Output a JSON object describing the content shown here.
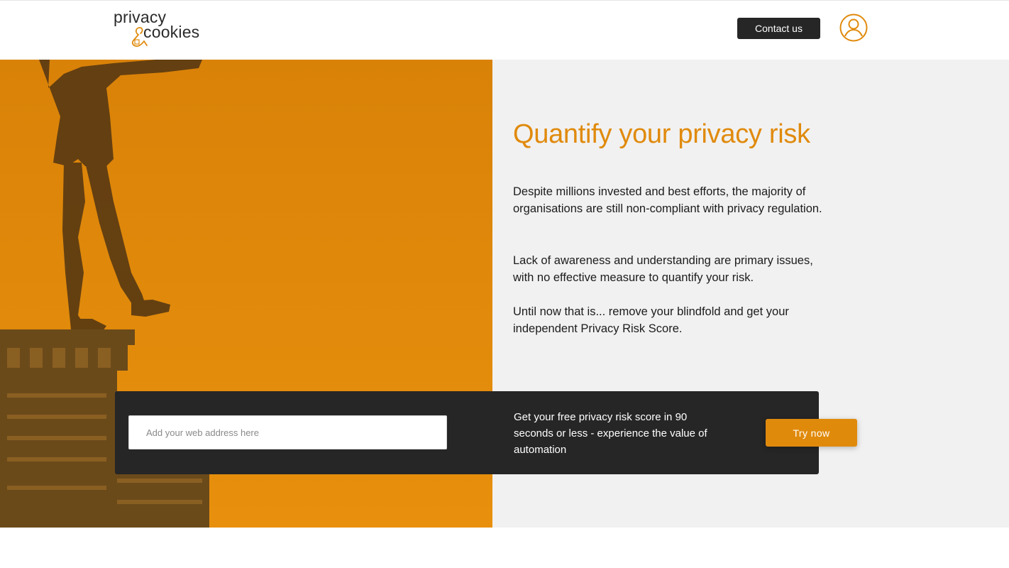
{
  "header": {
    "logo_line1": "privacy",
    "logo_line2": "cookies",
    "contact_label": "Contact us"
  },
  "hero": {
    "headline": "Quantify your privacy risk",
    "paragraphs": [
      "Despite millions invested and best efforts, the majority of organisations are still non-compliant with privacy regulation.",
      "Lack of awareness and understanding are primary issues, with no effective measure to quantify your risk.",
      "Until now that is... remove your blindfold and get your independent Privacy Risk Score."
    ]
  },
  "cta": {
    "input_placeholder": "Add your web address here",
    "input_value": "",
    "text": "Get your free privacy risk score in 90 seconds or less - experience the value of automation",
    "button_label": "Try now"
  },
  "colors": {
    "accent": "#e08a0c",
    "dark": "#262626",
    "panel": "#f1f1f1"
  },
  "icons": [
    "user-avatar-icon",
    "logo-ampersand-icon"
  ]
}
